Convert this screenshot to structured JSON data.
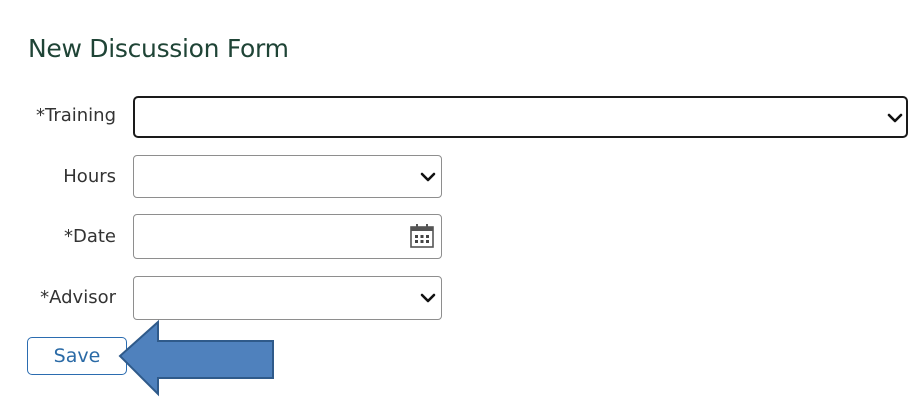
{
  "form": {
    "title": "New Discussion Form",
    "fields": {
      "training": {
        "label": "*Training",
        "value": ""
      },
      "hours": {
        "label": "Hours",
        "value": ""
      },
      "date": {
        "label": "*Date",
        "value": ""
      },
      "advisor": {
        "label": "*Advisor",
        "value": ""
      }
    },
    "save_label": "Save"
  },
  "icons": {
    "dropdown": "chevron-down-icon",
    "date": "calendar-icon",
    "annotation": "arrow-left-icon"
  },
  "colors": {
    "title": "#1f4436",
    "save_button_border": "#2b6cb0",
    "arrow_fill": "#4f81bd",
    "arrow_stroke": "#2f5a8a"
  }
}
